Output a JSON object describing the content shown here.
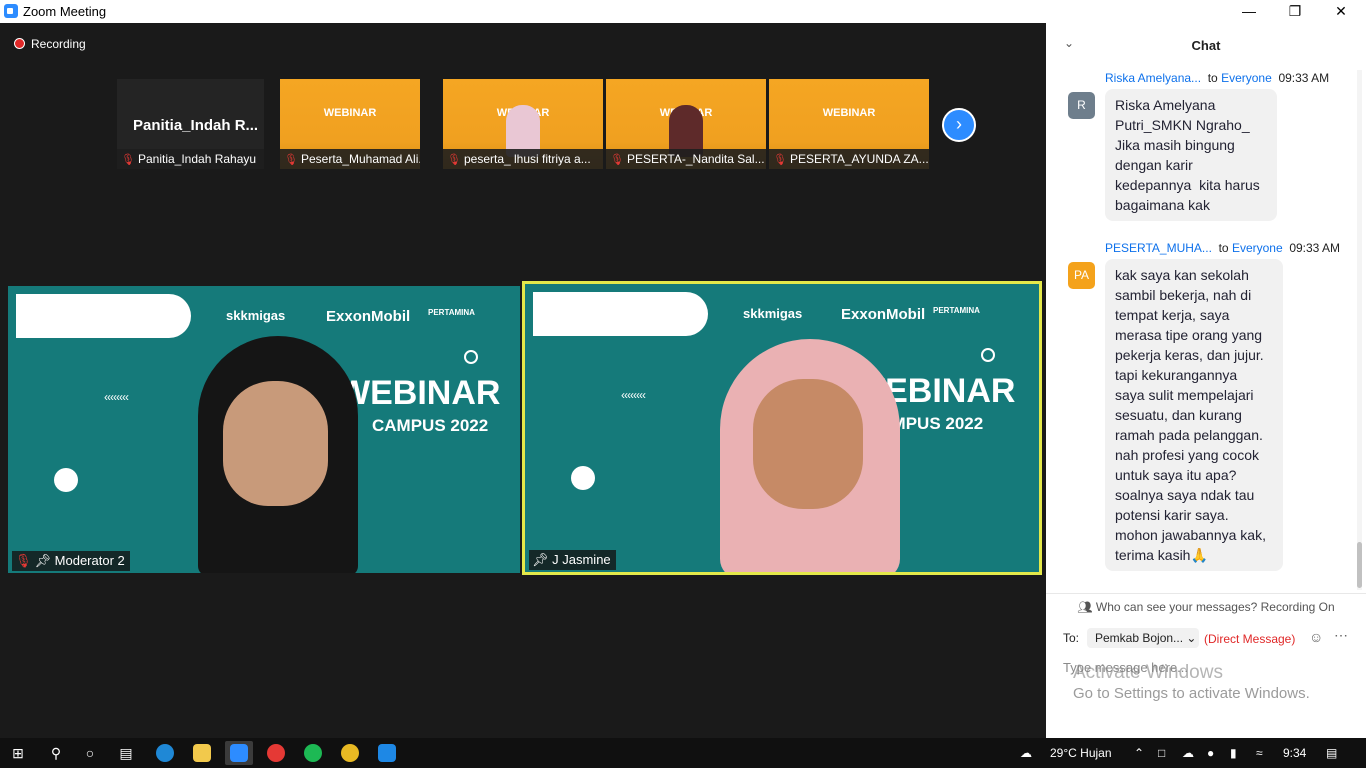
{
  "window": {
    "title": "Zoom Meeting"
  },
  "stage": {
    "recording_label": "Recording",
    "thumbnails": [
      {
        "name": "Panitia_Indah Rahayu",
        "card_text": "Panitia_Indah  R..."
      },
      {
        "name": "Peserta_Muhamad Ali..."
      },
      {
        "name": "peserta_ lhusi fitriya a..."
      },
      {
        "name": "PESERTA-_Nandita Sal..."
      },
      {
        "name": "PESERTA_AYUNDA ZA..."
      }
    ],
    "background_brand": {
      "webinar": "WEBINAR",
      "campus": "CAMPUS 2022",
      "sponsor1": "skkmigas",
      "sponsor2": "ExxonMobil",
      "sponsor3": "PERTAMINA"
    },
    "main_left": {
      "name": "Moderator 2"
    },
    "main_right": {
      "name": "J Jasmine"
    }
  },
  "chat": {
    "header": "Chat",
    "messages": [
      {
        "from": "Riska Amelyana...",
        "to_word": "to",
        "to": "Everyone",
        "time": "09:33 AM",
        "avatar": "R",
        "avatar_color": "#6e7e8c",
        "lines": [
          "Riska Amelyana",
          "Putri_SMKN Ngraho_",
          "Jika masih bingung",
          "dengan karir",
          "kedepannya  kita harus",
          "bagaimana kak"
        ]
      },
      {
        "from": "PESERTA_MUHA...",
        "to_word": "to",
        "to": "Everyone",
        "time": "09:33 AM",
        "avatar": "PA",
        "avatar_color": "#f4a21b",
        "lines": [
          "kak saya kan sekolah",
          "sambil bekerja, nah di",
          "tempat kerja, saya",
          "merasa tipe orang yang",
          "pekerja keras, dan jujur.",
          "tapi kekurangannya",
          "saya sulit mempelajari",
          "sesuatu, dan kurang",
          "ramah pada pelanggan.",
          "nah profesi yang cocok",
          "untuk saya itu apa?",
          "soalnya saya ndak tau",
          "potensi karir saya.",
          "mohon jawabannya kak,",
          "terima kasih🙏"
        ]
      }
    ],
    "privacy_note": "Who can see your messages? Recording On",
    "to_label": "To:",
    "recipient": "Pemkab Bojon...",
    "direct_label": "(Direct Message)",
    "input_placeholder": "Type message here...",
    "activate_title": "Activate Windows",
    "activate_sub": "Go to Settings to activate Windows."
  },
  "taskbar": {
    "weather": "29°C  Hujan",
    "time": "9:34"
  },
  "colors": {
    "accent": "#2d8cff",
    "teal_bg": "#157a7a",
    "speaker_border": "#e3e84a",
    "mute_red": "#e53935"
  }
}
